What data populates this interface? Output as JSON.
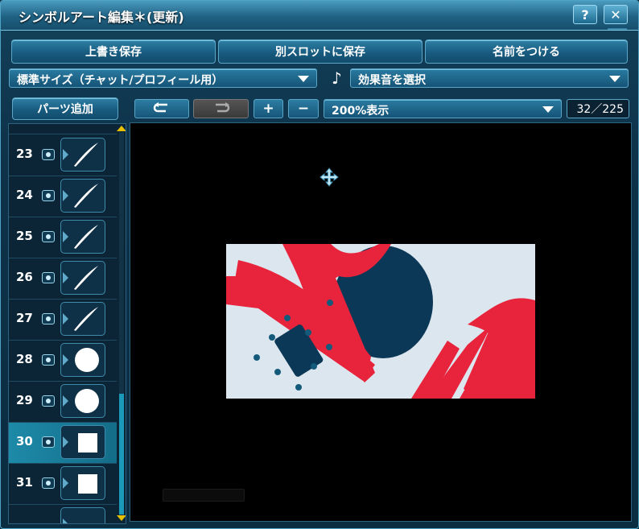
{
  "window": {
    "title": "シンボルアート編集＊(更新)",
    "help_label": "?",
    "close_label": "✕"
  },
  "actions": {
    "overwrite_save": "上書き保存",
    "save_other_slot": "別スロットに保存",
    "name_it": "名前をつける"
  },
  "size_select": {
    "value": "標準サイズ（チャット/プロフィール用）"
  },
  "sound": {
    "icon": "music-note-icon",
    "glyph": "♪",
    "value": "効果音を選択"
  },
  "parts": {
    "add_label": "パーツ追加",
    "rows": [
      {
        "num": "23",
        "shape": "stroke",
        "selected": false
      },
      {
        "num": "24",
        "shape": "stroke",
        "selected": false
      },
      {
        "num": "25",
        "shape": "stroke",
        "selected": false
      },
      {
        "num": "26",
        "shape": "stroke",
        "selected": false
      },
      {
        "num": "27",
        "shape": "stroke",
        "selected": false
      },
      {
        "num": "28",
        "shape": "circle",
        "selected": false
      },
      {
        "num": "29",
        "shape": "circle",
        "selected": false
      },
      {
        "num": "30",
        "shape": "square",
        "selected": true
      },
      {
        "num": "31",
        "shape": "square",
        "selected": false
      }
    ]
  },
  "toolbar": {
    "undo_icon": "undo-icon",
    "redo_icon": "redo-icon",
    "zoom_in": "+",
    "zoom_out": "−",
    "zoom_value": "200%表示",
    "counter": "32／225"
  },
  "colors": {
    "canvas_bg": "#000000",
    "art_bg": "#dce6ee",
    "art_red": "#e8233c",
    "art_navy": "#0c3858",
    "accent": "#1d8aa8"
  }
}
